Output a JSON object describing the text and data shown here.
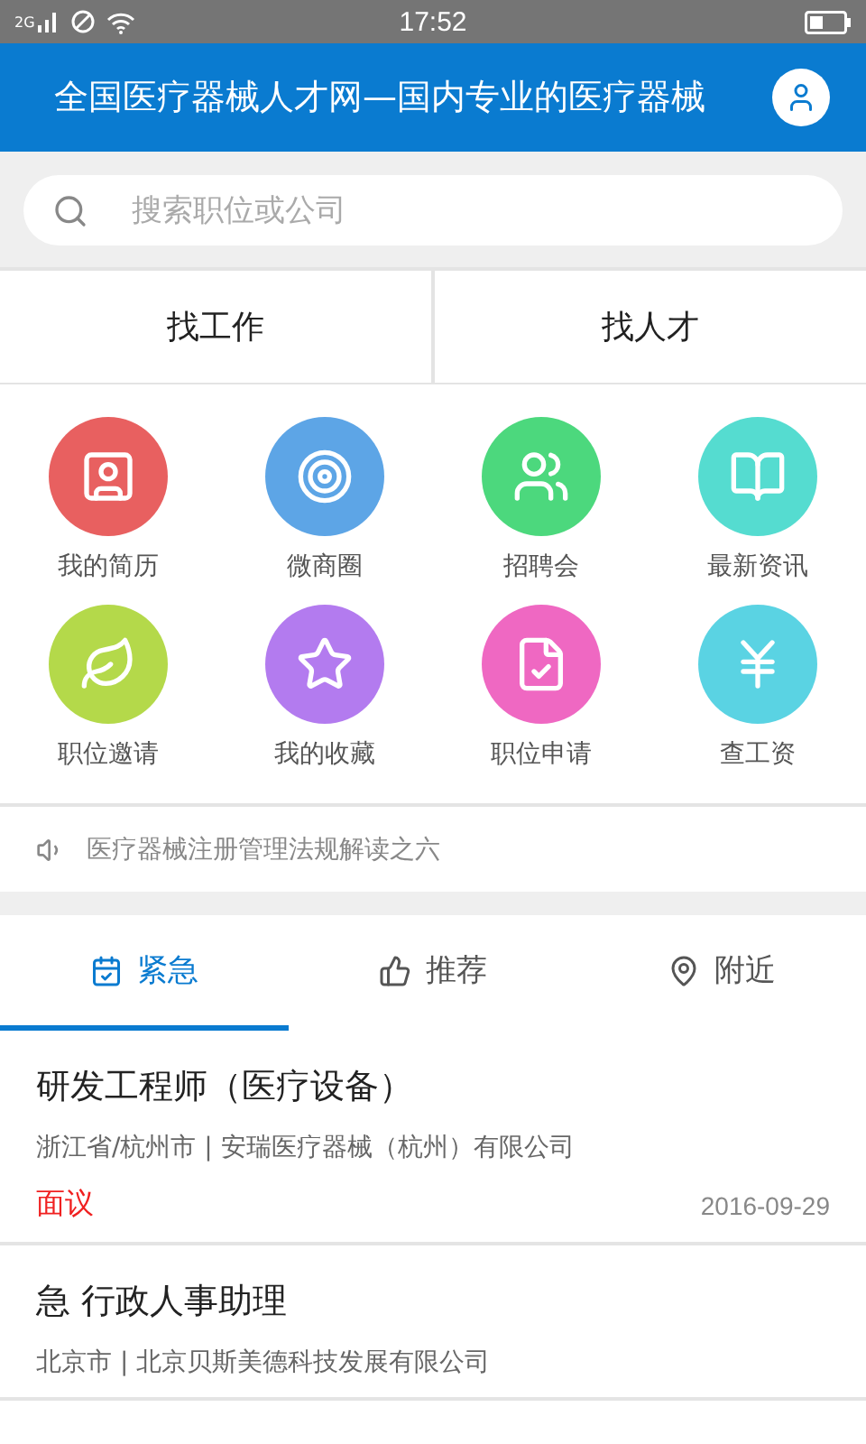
{
  "status_bar": {
    "network": "2G",
    "time": "17:52"
  },
  "header": {
    "title": "全国医疗器械人才网—国内专业的医疗器械"
  },
  "search": {
    "placeholder": "搜索职位或公司"
  },
  "mode_tabs": [
    {
      "label": "找工作"
    },
    {
      "label": "找人才"
    }
  ],
  "shortcuts": [
    {
      "label": "我的简历",
      "kind": "resume",
      "color": "#e86060"
    },
    {
      "label": "微商圈",
      "kind": "circle",
      "color": "#5da5e6"
    },
    {
      "label": "招聘会",
      "kind": "people",
      "color": "#4cd87d"
    },
    {
      "label": "最新资讯",
      "kind": "news",
      "color": "#55dcd0"
    },
    {
      "label": "职位邀请",
      "kind": "leaf",
      "color": "#b4d94a"
    },
    {
      "label": "我的收藏",
      "kind": "star",
      "color": "#b37bef"
    },
    {
      "label": "职位申请",
      "kind": "apply",
      "color": "#ef68c2"
    },
    {
      "label": "查工资",
      "kind": "salary",
      "color": "#5ad3e3"
    }
  ],
  "notice": {
    "text": "医疗器械注册管理法规解读之六"
  },
  "list_tabs": [
    {
      "label": "紧急",
      "kind": "urgent",
      "selected": true
    },
    {
      "label": "推荐",
      "kind": "recommend",
      "selected": false
    },
    {
      "label": "附近",
      "kind": "nearby",
      "selected": false
    }
  ],
  "jobs": [
    {
      "title": "研发工程师（医疗设备）",
      "location": "浙江省/杭州市 | 安瑞医疗器械（杭州）有限公司",
      "salary": "面议",
      "date": "2016-09-29"
    },
    {
      "title": "急 行政人事助理",
      "location": "北京市 | 北京贝斯美德科技发展有限公司"
    }
  ]
}
